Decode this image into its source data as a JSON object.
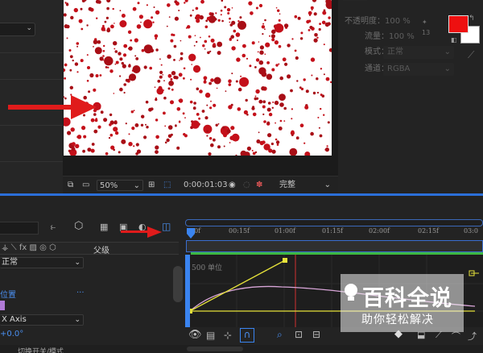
{
  "viewer": {
    "zoom": "50%",
    "timecode": "0:00:01:03",
    "quality": "完整"
  },
  "effects_panel": {
    "opacity_label": "不透明度",
    "opacity_value": "100 %",
    "flow_label": "流量",
    "flow_value": "100 %",
    "mode_label": "模式",
    "mode_value": "正常",
    "channel_label": "通道",
    "channel_value": "RGBA",
    "brush_size": "13",
    "fg_color": "#ee1010",
    "bg_color": "#ffffff"
  },
  "timeline": {
    "column_parent": "父级",
    "layer_mode": "正常",
    "position_label": "位置",
    "axis_label": "X Axis",
    "rotation_value": "+0.0°",
    "switch_toggle_label": "切换开关/模式",
    "graph_unit_label": "500 单位",
    "ticks": [
      "00f",
      "00:15f",
      "01:00f",
      "01:15f",
      "02:00f",
      "02:15f",
      "03:0"
    ]
  },
  "watermark": {
    "title": "百科全说",
    "subtitle": "助你轻松解决"
  },
  "accent_colors": {
    "timeline_blue": "#2b6fd9",
    "work_green": "#3cb843",
    "arrow_red": "#e01b1b",
    "curve_yellow": "#e6e23a",
    "curve_pink": "#d9a6d9"
  }
}
